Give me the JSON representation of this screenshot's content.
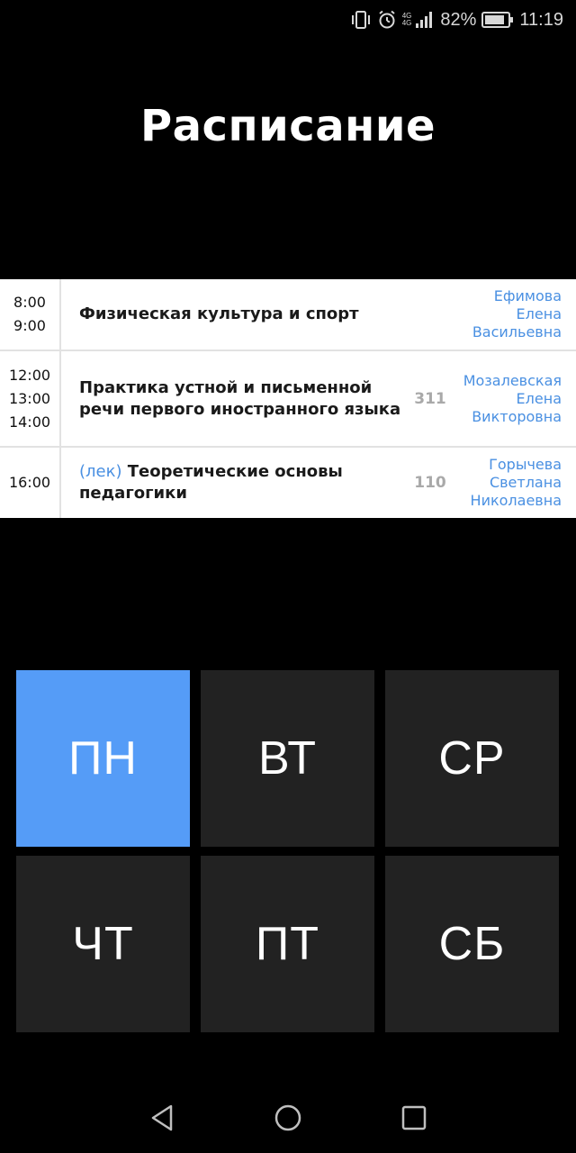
{
  "status_bar": {
    "net_type_top": "4G",
    "net_type_bottom": "4G",
    "battery": "82%",
    "time": "11:19"
  },
  "title": "Расписание",
  "schedule": [
    {
      "times": [
        "8:00",
        "9:00"
      ],
      "type": "",
      "subject": "Физическая культура и спорт",
      "room": "",
      "teacher": [
        "Ефимова",
        "Елена",
        "Васильевна"
      ]
    },
    {
      "times": [
        "12:00",
        "13:00",
        "14:00"
      ],
      "type": "",
      "subject": "Практика устной и письменной речи первого иностранного языка",
      "room": "311",
      "teacher": [
        "Мозалевская",
        "Елена",
        "Викторовна"
      ]
    },
    {
      "times": [
        "16:00"
      ],
      "type": "(лек)",
      "subject": "Теоретические основы педагогики",
      "room": "110",
      "teacher": [
        "Горычева",
        "Светлана",
        "Николаевна"
      ]
    }
  ],
  "days": [
    {
      "label": "ПН",
      "active": true
    },
    {
      "label": "ВТ",
      "active": false
    },
    {
      "label": "СР",
      "active": false
    },
    {
      "label": "ЧТ",
      "active": false
    },
    {
      "label": "ПТ",
      "active": false
    },
    {
      "label": "СБ",
      "active": false
    }
  ],
  "nav": {
    "back_icon": "back-triangle-icon",
    "home_icon": "home-circle-icon",
    "recents_icon": "recents-square-icon"
  },
  "colors": {
    "accent": "#559cf7",
    "day_bg": "#222222",
    "link_blue": "#4a90e2",
    "room_gray": "#a9a9a9"
  }
}
